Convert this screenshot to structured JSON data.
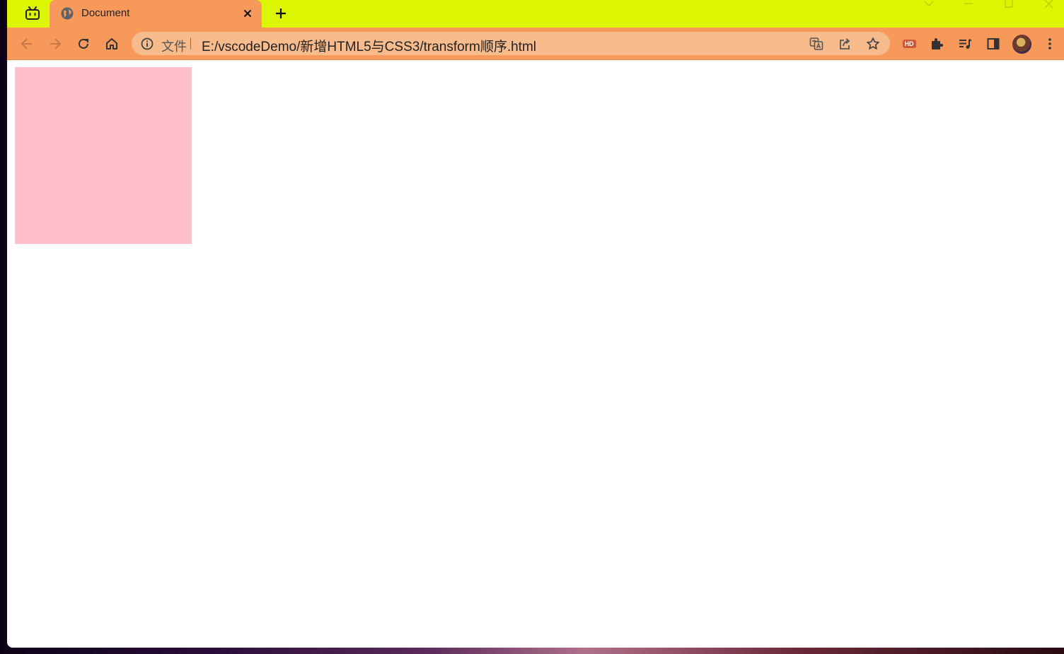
{
  "window": {
    "colors": {
      "titlebar": "#dcf500",
      "tab_active": "#f7995a",
      "toolbar": "#f7995a",
      "omnibox": "#f8bb8c"
    }
  },
  "tabs": [
    {
      "title": "Document",
      "favicon": "globe-icon",
      "active": true
    }
  ],
  "omnibox": {
    "info_icon": "info-icon",
    "label": "文件",
    "url": "E:/vscodeDemo/新增HTML5与CSS3/transform顺序.html"
  },
  "toolbar_icons": [
    "back-icon",
    "forward-icon",
    "reload-icon",
    "home-icon",
    "translate-icon",
    "share-icon",
    "star-icon",
    "hd-extension-icon",
    "puzzle-icon",
    "reading-list-icon",
    "side-panel-icon",
    "avatar",
    "kebab-menu-icon"
  ],
  "extensions": {
    "hd_label": "HD"
  },
  "page": {
    "box_color": "#ffc0cb"
  }
}
